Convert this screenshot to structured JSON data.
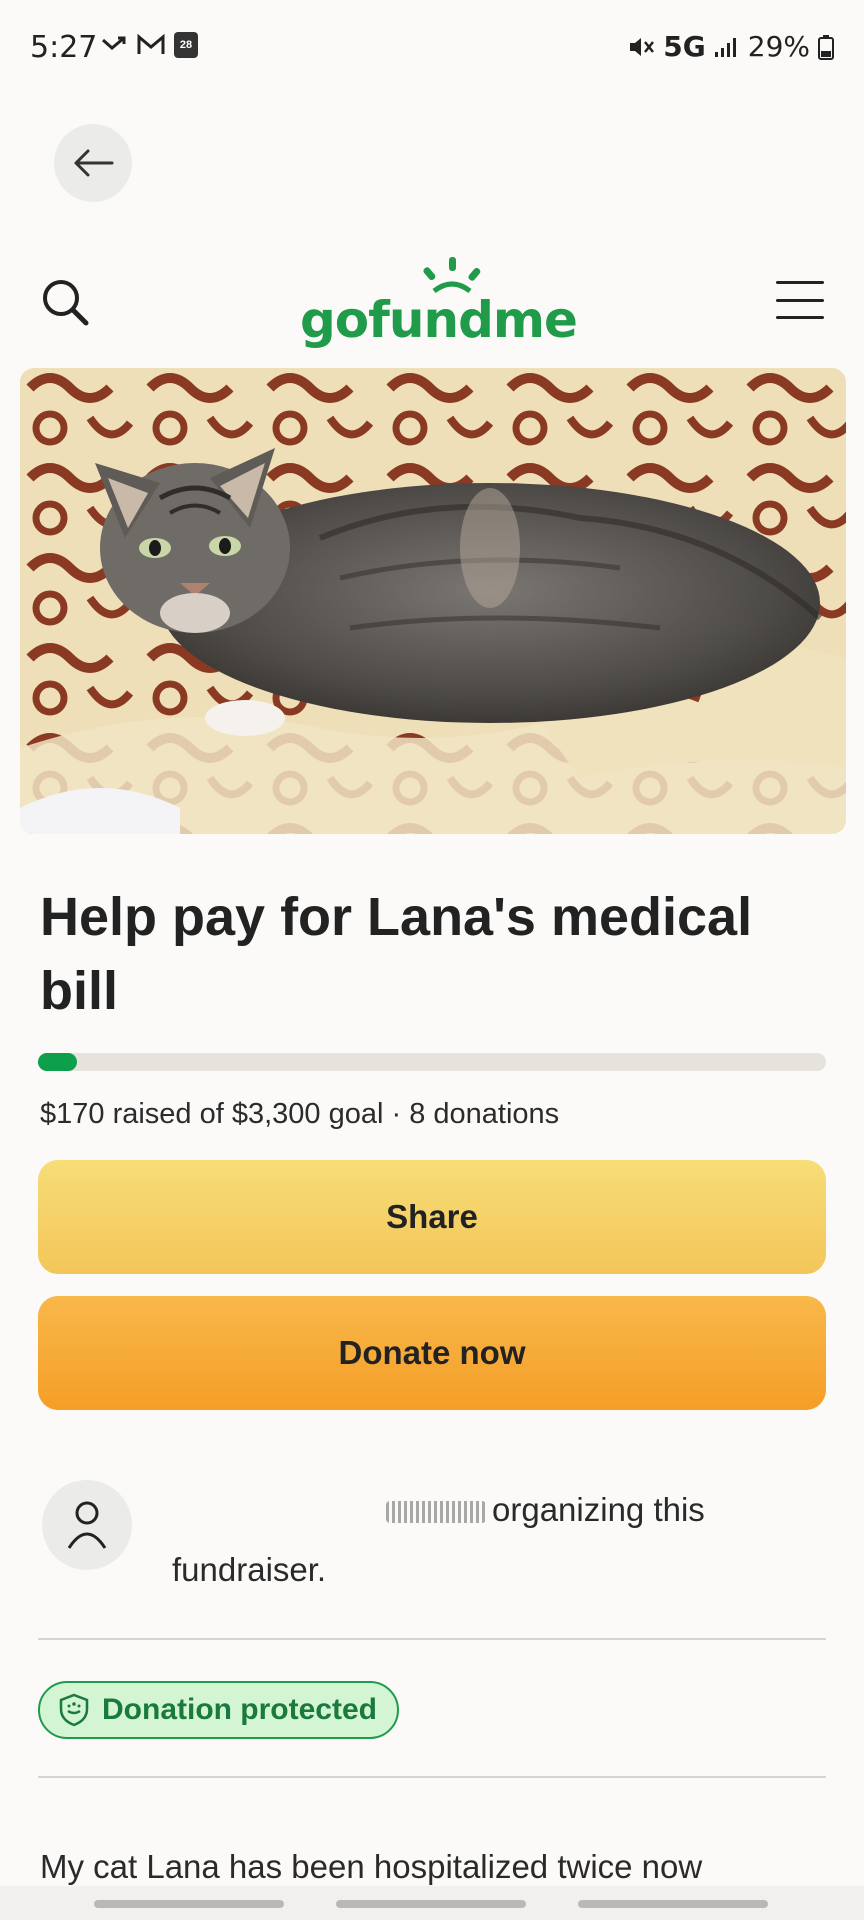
{
  "status_bar": {
    "time": "5:27",
    "calendar_date": "28",
    "network": "5G",
    "battery": "29%"
  },
  "nav": {
    "logo_text": "gofundme"
  },
  "campaign": {
    "title": "Help pay for Lana's medical bill",
    "raised_text": "$170 raised of $3,300 goal · 8 donations",
    "progress_fraction": 0.05,
    "share_label": "Share",
    "donate_label": "Donate now",
    "organizer_line1": "organizing this",
    "organizer_line2": "fundraiser.",
    "protected_label": "Donation protected",
    "story_preview": "My cat Lana has been hospitalized twice now"
  },
  "colors": {
    "brand_green": "#1f9b4a",
    "share_yellow": "#f5d066",
    "donate_orange": "#f7a93a"
  }
}
